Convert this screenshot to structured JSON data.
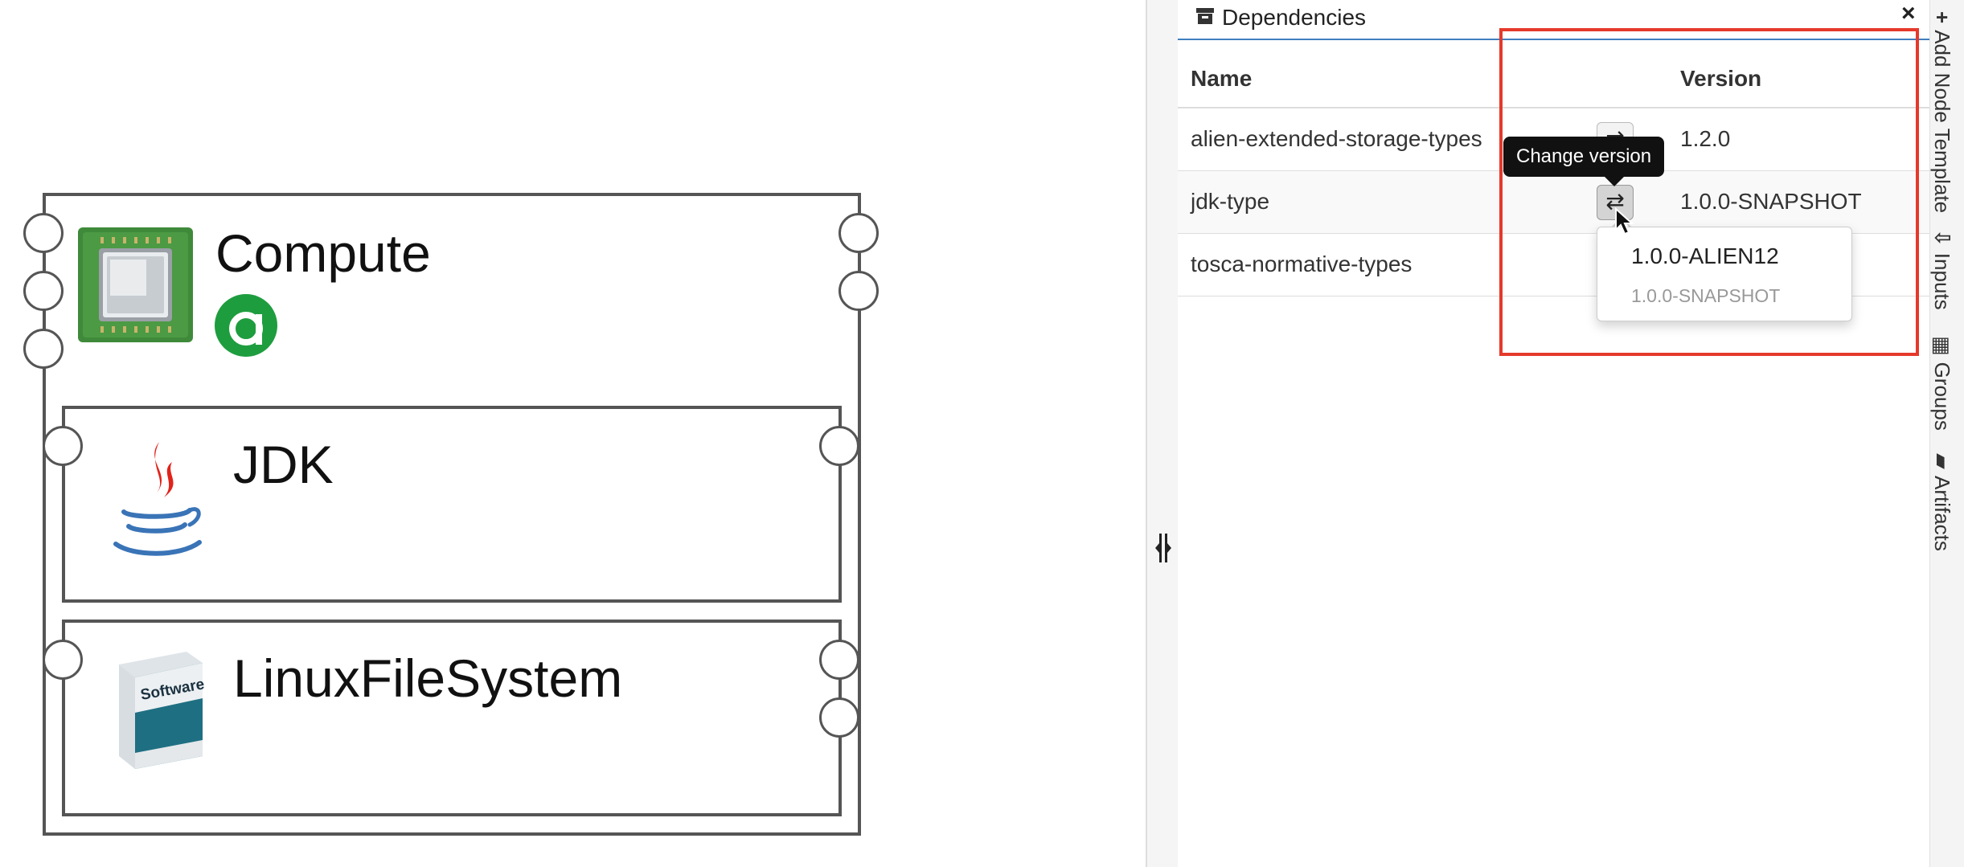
{
  "canvas": {
    "nodes": {
      "compute": {
        "title": "Compute",
        "badge_icon": "alien-a-icon"
      },
      "jdk": {
        "title": "JDK",
        "icon": "java-icon"
      },
      "fs": {
        "title": "LinuxFileSystem",
        "icon_label": "Software"
      }
    }
  },
  "panel": {
    "title": "Dependencies",
    "icon": "archive-icon",
    "close_glyph": "×",
    "columns": {
      "name": "Name",
      "version": "Version"
    },
    "rows": [
      {
        "name": "alien-extended-storage-types",
        "version": "1.2.0"
      },
      {
        "name": "jdk-type",
        "version": "1.0.0-SNAPSHOT"
      },
      {
        "name": "tosca-normative-types",
        "version": ""
      }
    ],
    "swap_glyph": "⇄",
    "tooltip": "Change version",
    "dropdown": [
      "1.0.0-ALIEN12",
      "1.0.0-SNAPSHOT"
    ]
  },
  "sidebar": {
    "tabs": [
      {
        "glyph": "+",
        "label": "Add Node Template"
      },
      {
        "glyph": "⇩",
        "label": "Inputs"
      },
      {
        "glyph": "▦",
        "label": "Groups"
      },
      {
        "glyph": "▰",
        "label": "Artifacts"
      }
    ]
  },
  "colors": {
    "highlight": "#e5392b",
    "header_rule": "#3f7fbf",
    "compute_badge": "#1e9d3f"
  }
}
